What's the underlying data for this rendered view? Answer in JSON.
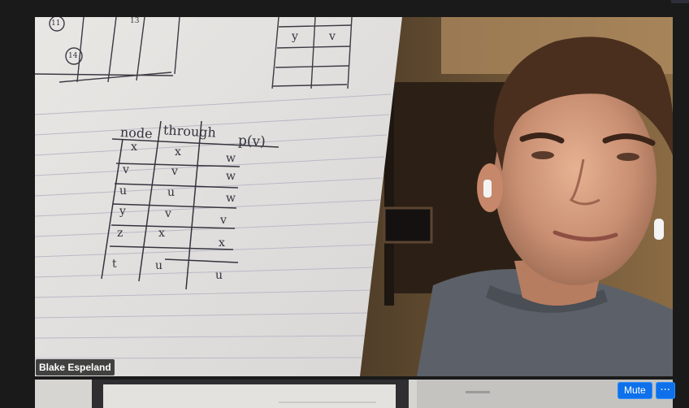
{
  "main_tile": {
    "participant_name": "Blake Espeland",
    "paper": {
      "table_headers": [
        "node",
        "through",
        "p(v)"
      ],
      "table_rows": [
        [
          "x",
          "x",
          "w"
        ],
        [
          "v",
          "v",
          "w"
        ],
        [
          "u",
          "u",
          "w"
        ],
        [
          "y",
          "v",
          "v"
        ],
        [
          "z",
          "x",
          "x"
        ],
        [
          "t",
          "u",
          "u"
        ]
      ],
      "top_right_cells": [
        "y",
        "v"
      ],
      "top_left_marks": [
        "13",
        "11",
        "14"
      ]
    }
  },
  "second_tile": {
    "mute_label": "Mute",
    "more_label": "···"
  },
  "colors": {
    "button_blue": "#0e71eb",
    "tile_background": "#1a1a1a",
    "label_background": "#141414"
  },
  "icons": {
    "more": "ellipsis-icon"
  }
}
